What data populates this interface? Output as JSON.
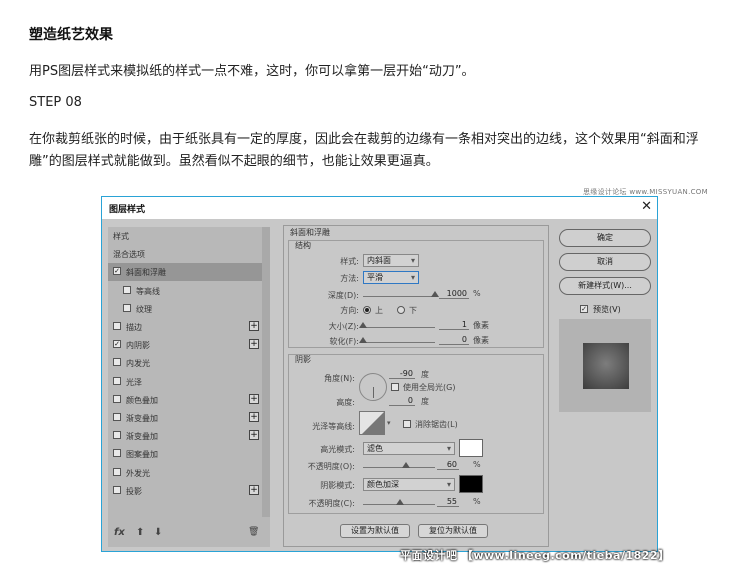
{
  "article": {
    "title": "塑造纸艺效果",
    "intro": "用PS图层样式来模拟纸的样式一点不难，这时，你可以拿第一层开始“动刀”。",
    "step": "STEP 08",
    "body": "在你裁剪纸张的时候，由于纸张具有一定的厚度，因此会在裁剪的边缘有一条相对突出的边线，这个效果用“斜面和浮雕”的图层样式就能做到。虽然看似不起眼的细节，也能让效果更逼真。",
    "watermark_top": "思缘设计论坛 www.MISSYUAN.COM",
    "watermark_bottom": "平面设计吧 【www.lineeg.com/tieba/1822】"
  },
  "dialog": {
    "title": "图层样式",
    "close_glyph": "✕",
    "sidebar": {
      "items": [
        {
          "label": "样式",
          "has_checkbox": false,
          "checked": false,
          "has_plus": false,
          "indent": false,
          "selected": false
        },
        {
          "label": "混合选项",
          "has_checkbox": false,
          "checked": false,
          "has_plus": false,
          "indent": false,
          "selected": false
        },
        {
          "label": "斜面和浮雕",
          "has_checkbox": true,
          "checked": true,
          "has_plus": false,
          "indent": false,
          "selected": true
        },
        {
          "label": "等高线",
          "has_checkbox": true,
          "checked": false,
          "has_plus": false,
          "indent": true,
          "selected": false
        },
        {
          "label": "纹理",
          "has_checkbox": true,
          "checked": false,
          "has_plus": false,
          "indent": true,
          "selected": false
        },
        {
          "label": "描边",
          "has_checkbox": true,
          "checked": false,
          "has_plus": true,
          "indent": false,
          "selected": false
        },
        {
          "label": "内阴影",
          "has_checkbox": true,
          "checked": true,
          "has_plus": true,
          "indent": false,
          "selected": false
        },
        {
          "label": "内发光",
          "has_checkbox": true,
          "checked": false,
          "has_plus": false,
          "indent": false,
          "selected": false
        },
        {
          "label": "光泽",
          "has_checkbox": true,
          "checked": false,
          "has_plus": false,
          "indent": false,
          "selected": false
        },
        {
          "label": "颜色叠加",
          "has_checkbox": true,
          "checked": false,
          "has_plus": true,
          "indent": false,
          "selected": false
        },
        {
          "label": "渐变叠加",
          "has_checkbox": true,
          "checked": false,
          "has_plus": true,
          "indent": false,
          "selected": false
        },
        {
          "label": "渐变叠加",
          "has_checkbox": true,
          "checked": false,
          "has_plus": true,
          "indent": false,
          "selected": false
        },
        {
          "label": "图案叠加",
          "has_checkbox": true,
          "checked": false,
          "has_plus": false,
          "indent": false,
          "selected": false
        },
        {
          "label": "外发光",
          "has_checkbox": true,
          "checked": false,
          "has_plus": false,
          "indent": false,
          "selected": false
        },
        {
          "label": "投影",
          "has_checkbox": true,
          "checked": false,
          "has_plus": true,
          "indent": false,
          "selected": false
        }
      ],
      "footer": {
        "fx": "fx",
        "up": "⬆",
        "down": "⬇",
        "trash": "🗑"
      }
    },
    "bevel": {
      "section_title": "斜面和浮雕",
      "structure_title": "结构",
      "style_label": "样式:",
      "style_value": "内斜面",
      "technique_label": "方法:",
      "technique_value": "平滑",
      "depth_label": "深度(D):",
      "depth_value": "1000",
      "depth_unit": "%",
      "depth_level": 1.0,
      "direction_label": "方向:",
      "direction_up": "上",
      "direction_down": "下",
      "direction_selected": "上",
      "size_label": "大小(Z):",
      "size_value": "1",
      "size_unit": "像素",
      "soften_label": "软化(F):",
      "soften_value": "0",
      "soften_unit": "像素"
    },
    "shading": {
      "title": "阴影",
      "angle_label": "角度(N):",
      "angle_value": "-90",
      "angle_unit": "度",
      "global_light_label": "使用全局光(G)",
      "global_light_checked": false,
      "altitude_label": "高度:",
      "altitude_value": "0",
      "altitude_unit": "度",
      "gloss_contour_label": "光泽等高线:",
      "anti_alias_label": "消除锯齿(L)",
      "highlight_mode_label": "高光模式:",
      "highlight_mode_value": "滤色",
      "highlight_color": "#ffffff",
      "highlight_opacity_label": "不透明度(O):",
      "highlight_opacity_value": "60",
      "highlight_opacity_unit": "%",
      "shadow_mode_label": "阴影模式:",
      "shadow_mode_value": "颜色加深",
      "shadow_color": "#000000",
      "shadow_opacity_label": "不透明度(C):",
      "shadow_opacity_value": "55",
      "shadow_opacity_unit": "%"
    },
    "buttons": {
      "set_default": "设置为默认值",
      "reset_default": "复位为默认值",
      "ok": "确定",
      "cancel": "取消",
      "new_style": "新建样式(W)...",
      "preview_label": "预览(V)",
      "preview_checked": true
    }
  }
}
